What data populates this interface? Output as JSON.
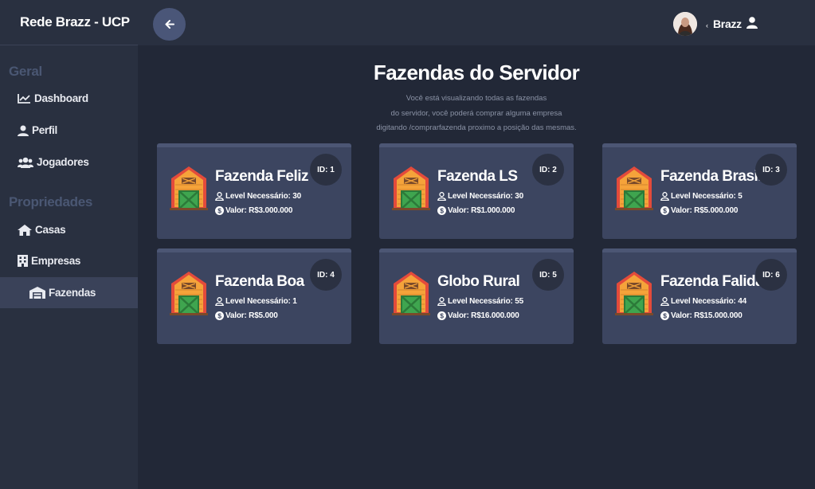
{
  "app": {
    "brand": "Rede Brazz - UCP"
  },
  "sidebar": {
    "sections": [
      {
        "title": "Geral"
      },
      {
        "title": "Propriedades"
      }
    ],
    "items": [
      {
        "label": "Dashboard",
        "icon": "chart-line-icon"
      },
      {
        "label": "Perfil",
        "icon": "user-icon"
      },
      {
        "label": "Jogadores",
        "icon": "users-icon"
      },
      {
        "label": "Casas",
        "icon": "house-icon"
      },
      {
        "label": "Empresas",
        "icon": "building-icon"
      },
      {
        "label": "Fazendas",
        "icon": "warehouse-icon",
        "active": true
      }
    ]
  },
  "header": {
    "user_name": "Brazz",
    "caret": "‹"
  },
  "main": {
    "title": "Fazendas do Servidor",
    "subtitle_lines": [
      "Você está visualizando todas as fazendas",
      "do servidor, você poderá comprar alguma empresa",
      "digitando /comprarfazenda proximo a posição das mesmas."
    ]
  },
  "farms": [
    {
      "id": "ID: 1",
      "name": "Fazenda Feliz",
      "level": "Level Necessário: 30",
      "value": "Valor: R$3.000.000"
    },
    {
      "id": "ID: 2",
      "name": "Fazenda LS",
      "level": "Level Necessário: 30",
      "value": "Valor: R$1.000.000"
    },
    {
      "id": "ID: 3",
      "name": "Fazenda Brasil",
      "level": "Level Necessário: 5",
      "value": "Valor: R$5.000.000"
    },
    {
      "id": "ID: 4",
      "name": "Fazenda Boa",
      "level": "Level Necessário: 1",
      "value": "Valor: R$5.000"
    },
    {
      "id": "ID: 5",
      "name": "Globo Rural",
      "level": "Level Necessário: 55",
      "value": "Valor: R$16.000.000"
    },
    {
      "id": "ID: 6",
      "name": "Fazenda Falida",
      "level": "Level Necessário: 44",
      "value": "Valor: R$15.000.000"
    }
  ],
  "colors": {
    "background": "#222837",
    "sidebar": "#293040",
    "card": "#3c4560",
    "accent": "#4a5678"
  }
}
